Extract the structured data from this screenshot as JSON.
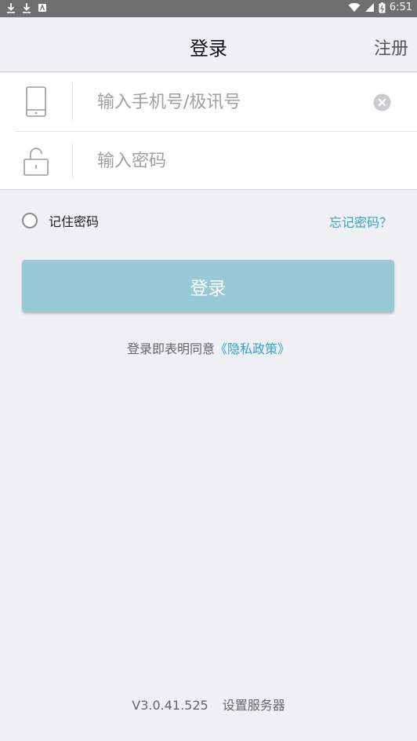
{
  "status_bar": {
    "time": "6:51",
    "left_icons": [
      "download-icon",
      "download-icon",
      "notification-icon"
    ],
    "right_icons": [
      "wifi-icon",
      "signal-icon",
      "battery-icon"
    ]
  },
  "nav": {
    "title": "登录",
    "register_label": "注册"
  },
  "form": {
    "phone_placeholder": "输入手机号/极讯号",
    "phone_value": "",
    "password_placeholder": "输入密码",
    "password_value": ""
  },
  "remember": {
    "label": "记住密码",
    "checked": false
  },
  "forgot_label": "忘记密码？",
  "login_button_label": "登录",
  "agreement": {
    "prefix": "登录即表明同意",
    "link": "《隐私政策》"
  },
  "footer": {
    "version": "V3.0.41.525",
    "server_label": "设置服务器"
  },
  "colors": {
    "accent": "#33a3c9",
    "login_button": "#98cad6",
    "background": "#efeff4",
    "status_bar": "#6f6f6f"
  }
}
